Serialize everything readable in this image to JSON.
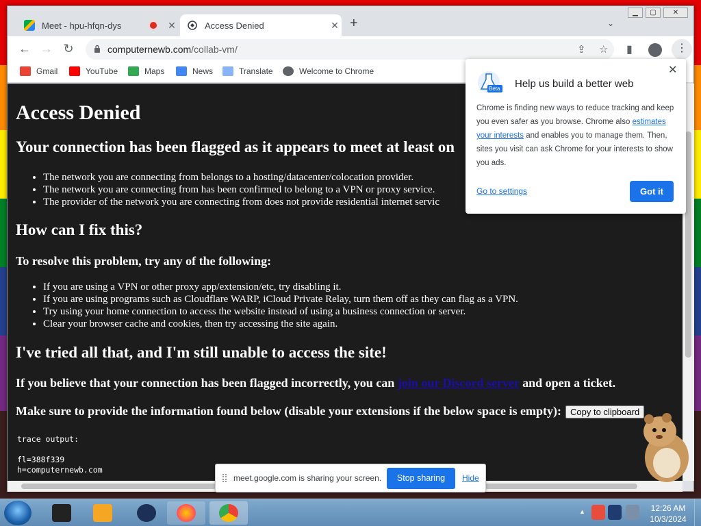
{
  "browser": {
    "tabs": [
      {
        "label": "Meet - hpu-hfqn-dys",
        "recording": true
      },
      {
        "label": "Access Denied",
        "active": true
      }
    ],
    "new_tab": "+",
    "url_host": "computernewb.com",
    "url_path": "/collab-vm/",
    "bookmarks": [
      {
        "label": "Gmail",
        "icon": "gmail-icon",
        "color": "#ea4335"
      },
      {
        "label": "YouTube",
        "icon": "youtube-icon",
        "color": "#ff0000"
      },
      {
        "label": "Maps",
        "icon": "maps-icon",
        "color": "#34a853"
      },
      {
        "label": "News",
        "icon": "news-icon",
        "color": "#4285f4"
      },
      {
        "label": "Translate",
        "icon": "translate-icon",
        "color": "#4285f4"
      },
      {
        "label": "Welcome to Chrome",
        "icon": "chrome-icon",
        "color": "#5f6368"
      }
    ]
  },
  "page": {
    "title": "Access Denied",
    "flag_heading": "Your connection has been flagged as it appears to meet at least on",
    "flag_reasons": [
      "The network you are connecting from belongs to a hosting/datacenter/colocation provider.",
      "The network you are connecting from has been confirmed to belong to a VPN or proxy service.",
      "The provider of the network you are connecting from does not provide residential internet servic"
    ],
    "fix_heading": "How can I fix this?",
    "resolve_heading": "To resolve this problem, try any of the following:",
    "fixes": [
      "If you are using a VPN or other proxy app/extension/etc, try disabling it.",
      "If you are using programs such as Cloudflare WARP, iCloud Private Relay, turn them off as they can flag as a VPN.",
      "Try using your home connection to access the website instead of using a business connection or server.",
      "Clear your browser cache and cookies, then try accessing the site again."
    ],
    "tried_heading": "I've tried all that, and I'm still unable to access the site!",
    "incorrect_text_before": "If you believe that your connection has been flagged incorrectly, you can ",
    "incorrect_link": "join our Discord server",
    "incorrect_text_after": " and open a ticket.",
    "provide_text": "Make sure to provide the information found below (disable your extensions if the below space is empty):",
    "copy_button": "Copy to clipboard",
    "trace": "trace output:\n\nfl=388f339\nh=computernewb.com"
  },
  "popup": {
    "title": "Help us build a better web",
    "body_before": "Chrome is finding new ways to reduce tracking and keep you even safer as you browse. Chrome also ",
    "body_link": "estimates your interests",
    "body_after": " and enables you to manage them. Then, sites you visit can ask Chrome for your interests to show you ads.",
    "settings_link": "Go to settings",
    "got_it": "Got it",
    "badge": "Beta"
  },
  "share_bar": {
    "text": "meet.google.com is sharing your screen.",
    "stop": "Stop sharing",
    "hide": "Hide"
  },
  "taskbar": {
    "time": "12:26 AM",
    "date": "10/3/2024"
  }
}
